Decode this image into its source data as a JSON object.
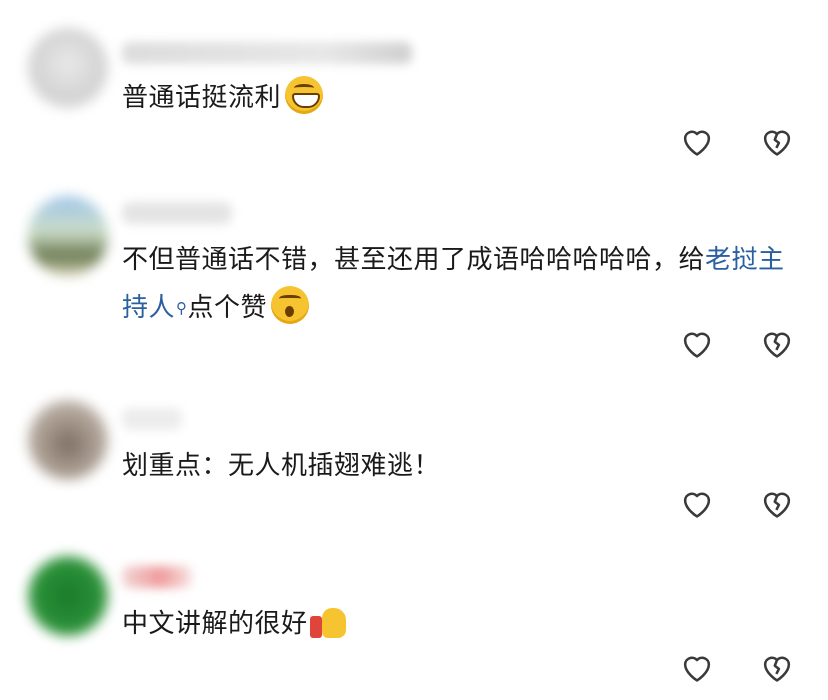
{
  "comments": [
    {
      "text": "普通话挺流利",
      "emoji": "grinning-face-icon"
    },
    {
      "text_before": "不但普通话不错，甚至还用了成语哈哈哈哈哈，给",
      "link": "老挝主持人",
      "search_glyph": "⚲",
      "text_after": "点个赞",
      "emoji": "astonished-face-icon"
    },
    {
      "text": "划重点：无人机插翅难逃！"
    },
    {
      "text": "中文讲解的很好",
      "emoji": "thumbs-up-icon"
    }
  ],
  "icons": {
    "like": "heart-outline-icon",
    "dislike": "broken-heart-outline-icon"
  },
  "colors": {
    "link": "#2a5fa0",
    "icon_stroke": "#3a3a3a"
  }
}
